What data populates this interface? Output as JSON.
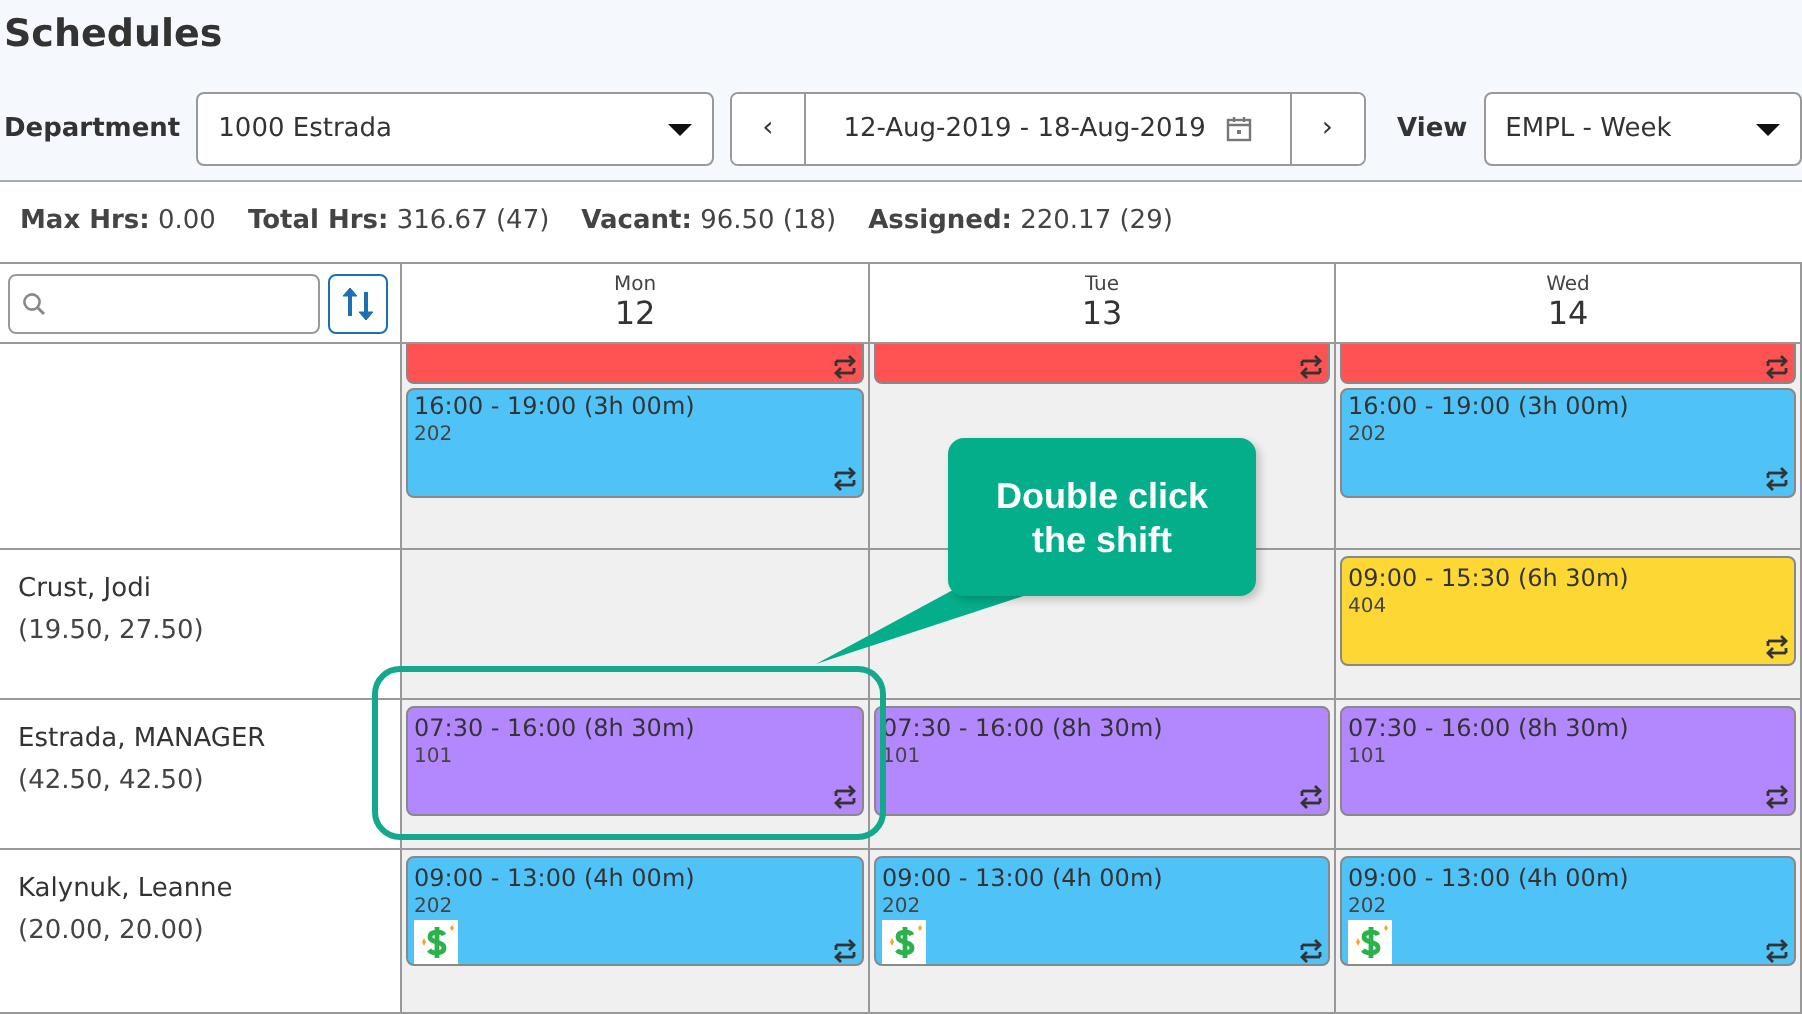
{
  "title": "Schedules",
  "toolbar": {
    "department_label": "Department",
    "department": "1000 Estrada",
    "prev": "‹",
    "date_range": "12-Aug-2019 - 18-Aug-2019",
    "next": "›",
    "view_label": "View",
    "view": "EMPL - Week"
  },
  "stats": [
    "**Max Hrs:** 0.00",
    "**Total Hrs:** 316.67 (47)",
    "**Vacant:** 96.50 (18)",
    "**Assigned:** 220.17 (29)"
  ],
  "days": [
    {
      "name": "Mon",
      "date": "12"
    },
    {
      "name": "Tue",
      "date": "13"
    },
    {
      "name": "Wed",
      "date": "14"
    }
  ],
  "rows": [
    {
      "mon": [
        {
          "kind": "partial",
          "color": "#ff5252"
        },
        {
          "kind": "full",
          "time": "16:00 - 19:00 (3h 00m)",
          "code": "202",
          "color": "#4fc3f7",
          "pay": false,
          "highlighted": false
        }
      ],
      "tue": [
        {
          "kind": "partial",
          "color": "#ff5252"
        }
      ],
      "wed": [
        {
          "kind": "partial",
          "color": "#ff5252"
        },
        {
          "kind": "full",
          "time": "16:00 - 19:00 (3h 00m)",
          "code": "202",
          "color": "#4fc3f7",
          "pay": false,
          "highlighted": false
        }
      ]
    },
    {
      "employee": "Crust, Jodi",
      "hours": "(19.50, 27.50)",
      "wed": [
        {
          "kind": "full",
          "time": "09:00 - 15:30 (6h 30m)",
          "code": "404",
          "color": "#fdd835",
          "pay": false,
          "highlighted": false
        }
      ]
    },
    {
      "employee": "Estrada, MANAGER",
      "hours": "(42.50, 42.50)",
      "mon": [
        {
          "kind": "full",
          "time": "07:30 - 16:00 (8h 30m)",
          "code": "101",
          "color": "#b388ff",
          "pay": false,
          "highlighted": true
        }
      ],
      "tue": [
        {
          "kind": "full",
          "time": "07:30 - 16:00 (8h 30m)",
          "code": "101",
          "color": "#b388ff",
          "pay": false,
          "highlighted": false
        }
      ],
      "wed": [
        {
          "kind": "full",
          "time": "07:30 - 16:00 (8h 30m)",
          "code": "101",
          "color": "#b388ff",
          "pay": false,
          "highlighted": false
        }
      ]
    },
    {
      "employee": "Kalynuk, Leanne",
      "hours": "(20.00, 20.00)",
      "mon": [
        {
          "kind": "full",
          "time": "09:00 - 13:00 (4h 00m)",
          "code": "202",
          "color": "#4fc3f7",
          "pay": true,
          "highlighted": false
        }
      ],
      "tue": [
        {
          "kind": "full",
          "time": "09:00 - 13:00 (4h 00m)",
          "code": "202",
          "color": "#4fc3f7",
          "pay": true,
          "highlighted": false
        }
      ],
      "wed": [
        {
          "kind": "full",
          "time": "09:00 - 13:00 (4h 00m)",
          "code": "202",
          "color": "#4fc3f7",
          "pay": true,
          "highlighted": false
        }
      ]
    }
  ],
  "callout": {
    "text": "Double click the shift"
  }
}
